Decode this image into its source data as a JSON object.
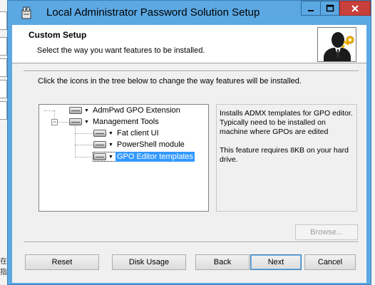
{
  "window": {
    "title": "Local Administrator Password Solution Setup",
    "min_icon": "minimize-icon",
    "max_icon": "maximize-icon",
    "close_icon": "close-icon",
    "title_bar_color": "#5ba8e3",
    "close_color": "#c7403b"
  },
  "header": {
    "title": "Custom Setup",
    "subtitle": "Select the way you want features to be installed."
  },
  "instruction": "Click the icons in the tree below to change the way features will be installed.",
  "tree": {
    "items": [
      {
        "label": "AdmPwd GPO Extension",
        "level": 0,
        "expander": "",
        "selected": false
      },
      {
        "label": "Management Tools",
        "level": 0,
        "expander": "−",
        "selected": false
      },
      {
        "label": "Fat client UI",
        "level": 1,
        "expander": "",
        "selected": false
      },
      {
        "label": "PowerShell module",
        "level": 1,
        "expander": "",
        "selected": false
      },
      {
        "label": "GPO Editor templates",
        "level": 1,
        "expander": "",
        "selected": true
      }
    ],
    "selection_color": "#3399ff"
  },
  "description": {
    "text": "Installs ADMX templates for GPO editor. Typically need to be installed on machine where GPOs are edited",
    "size_note": "This feature requires 8KB on your hard drive."
  },
  "buttons": {
    "browse": "Browse...",
    "reset": "Reset",
    "disk_usage": "Disk Usage",
    "back": "Back",
    "next": "Next",
    "cancel": "Cancel"
  },
  "background": {
    "left_glyph": "在指"
  }
}
